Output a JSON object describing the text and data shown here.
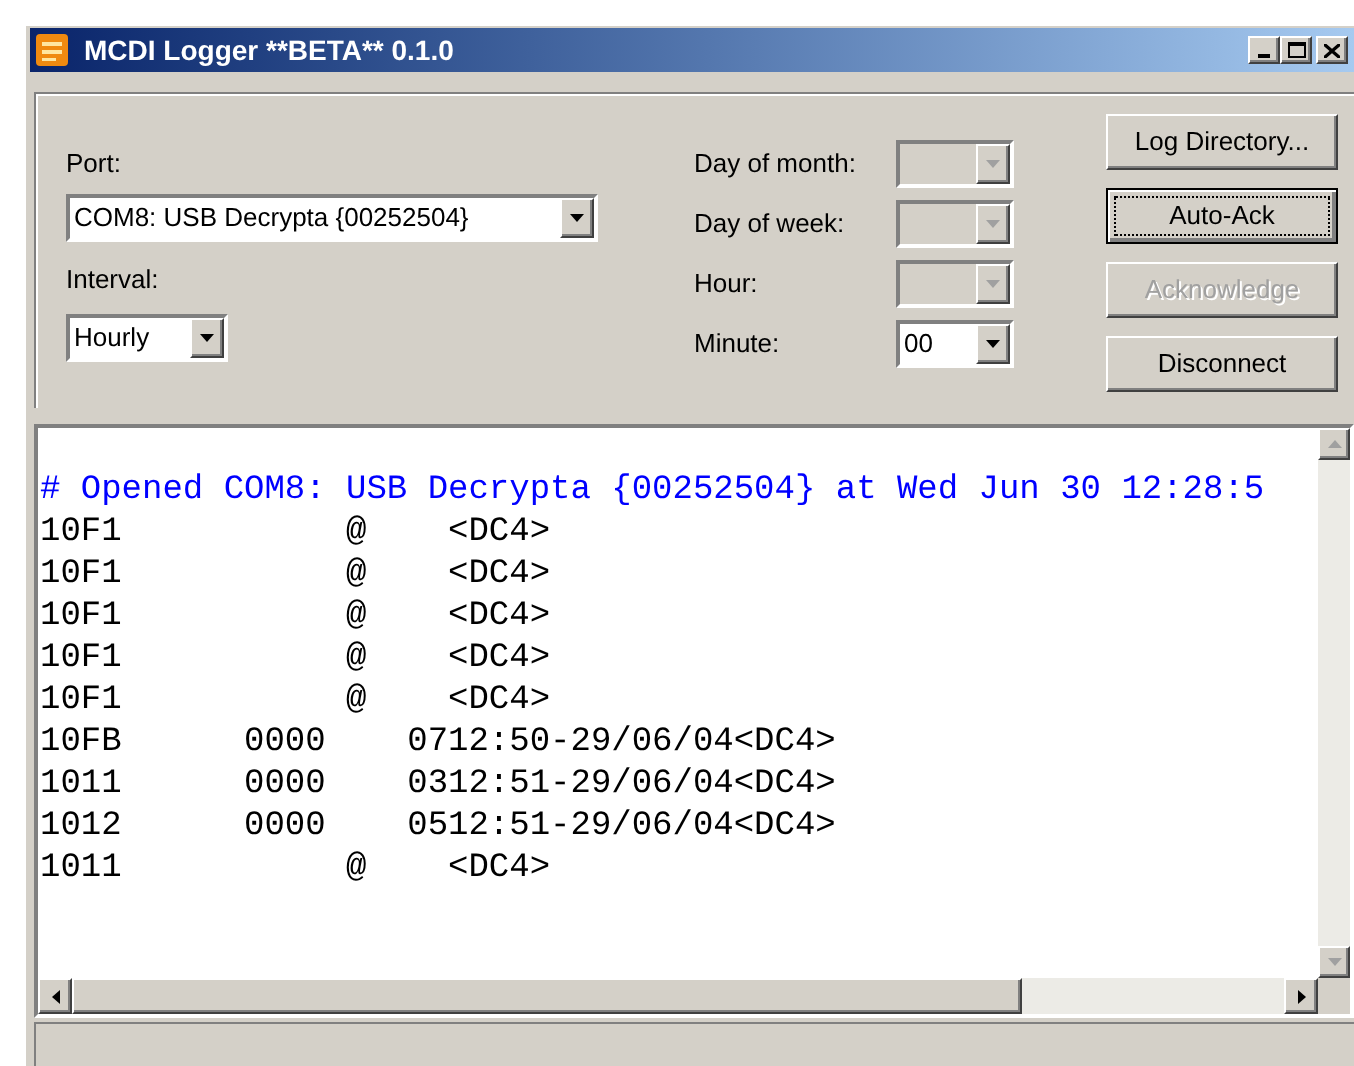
{
  "window": {
    "title": "MCDI Logger **BETA** 0.1.0"
  },
  "settings": {
    "port": {
      "label": "Port:",
      "value": "COM8: USB Decrypta {00252504}"
    },
    "interval": {
      "label": "Interval:",
      "value": "Hourly"
    }
  },
  "schedule": [
    {
      "label": "Day of month:",
      "disabled": true
    },
    {
      "label": "Day of week:",
      "disabled": true
    },
    {
      "label": "Hour:",
      "disabled": true
    },
    {
      "label": "Minute:",
      "value": "00",
      "disabled": false
    }
  ],
  "buttons": [
    {
      "label": "Log Directory...",
      "disabled": false,
      "focused": false
    },
    {
      "label": "Auto-Ack",
      "disabled": false,
      "focused": true
    },
    {
      "label": "Acknowledge",
      "disabled": true,
      "focused": false
    },
    {
      "label": "Disconnect",
      "disabled": false,
      "focused": false
    }
  ],
  "log": {
    "lines": [
      {
        "kind": "header",
        "text": "# Opened COM8: USB Decrypta {00252504} at Wed Jun 30 12:28:5"
      },
      {
        "kind": "data",
        "text": "10F1           @    <DC4>"
      },
      {
        "kind": "data",
        "text": "10F1           @    <DC4>"
      },
      {
        "kind": "data",
        "text": "10F1           @    <DC4>"
      },
      {
        "kind": "data",
        "text": "10F1           @    <DC4>"
      },
      {
        "kind": "data",
        "text": "10F1           @    <DC4>"
      },
      {
        "kind": "data",
        "text": "10FB      0000    0712:50-29/06/04<DC4>"
      },
      {
        "kind": "data",
        "text": "1011      0000    0312:51-29/06/04<DC4>"
      },
      {
        "kind": "data",
        "text": "1012      0000    0512:51-29/06/04<DC4>"
      },
      {
        "kind": "data",
        "text": "1011           @    <DC4>"
      }
    ]
  }
}
